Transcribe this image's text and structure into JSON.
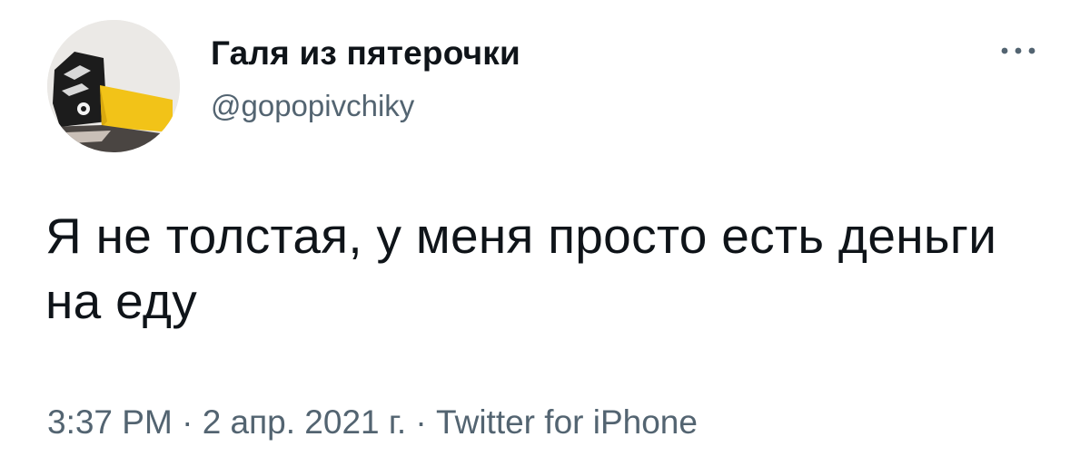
{
  "tweet": {
    "author": {
      "display_name": "Галя из пятерочки",
      "handle": "@gopopivchiky",
      "avatar_icon": "avatar-photo-sneaker-yellow-sock"
    },
    "more_icon": "more-horizontal-icon",
    "text": "Я не толстая, у меня просто есть деньги на еду",
    "meta": {
      "time": "3:37 PM",
      "separator": " · ",
      "date": "2 апр. 2021 г.",
      "source": "Twitter for iPhone"
    }
  },
  "colors": {
    "text_primary": "#0f1419",
    "text_secondary": "#536471",
    "background": "#ffffff",
    "accent_sock": "#f2c318"
  }
}
